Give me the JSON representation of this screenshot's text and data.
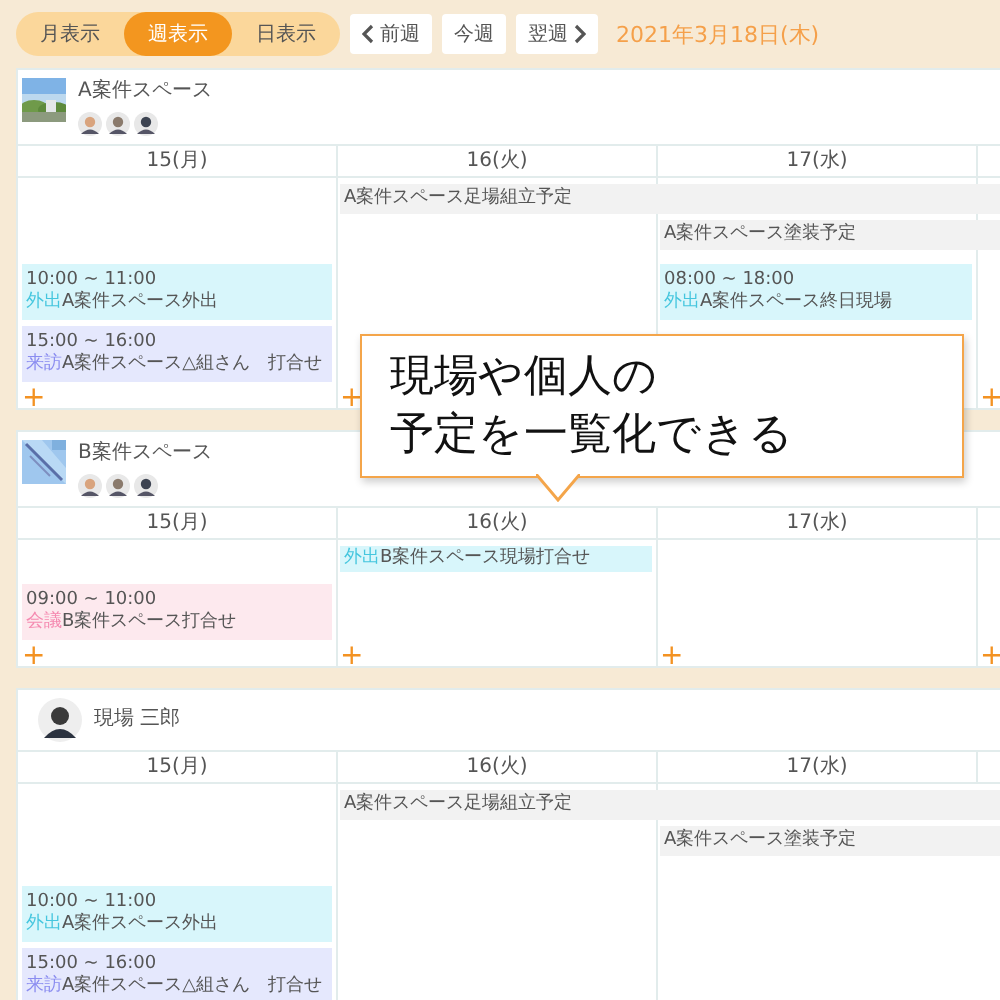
{
  "toolbar": {
    "views": [
      {
        "label": "月表示",
        "selected": false
      },
      {
        "label": "週表示",
        "selected": true
      },
      {
        "label": "日表示",
        "selected": false
      }
    ],
    "nav": [
      {
        "label": "前週",
        "kind": "prev"
      },
      {
        "label": "今週",
        "kind": "today"
      },
      {
        "label": "翌週",
        "kind": "next"
      }
    ],
    "date": "2021年3月18日(木)"
  },
  "cards": [
    {
      "kind": "space",
      "title": "A案件スペース",
      "days": [
        {
          "label": "15(月)",
          "add": "+",
          "events": [
            {
              "kind": "outing",
              "time": "10:00 ~ 11:00",
              "tag": "外出",
              "text": "A案件スペース外出"
            },
            {
              "kind": "visit",
              "time": "15:00 ~ 16:00",
              "tag": "来訪",
              "text": "A案件スペース△組さん　打合せ"
            }
          ]
        },
        {
          "label": "16(火)",
          "add": "+",
          "events": [
            {
              "kind": "bar",
              "text": "A案件スペース足場組立予定",
              "continues": true
            }
          ]
        },
        {
          "label": "17(水)",
          "events": [
            {
              "kind": "bar",
              "text": "A案件スペース塗装予定",
              "continues": true
            },
            {
              "kind": "outing",
              "time": "08:00 ~ 18:00",
              "tag": "外出",
              "text": "A案件スペース終日現場"
            }
          ]
        },
        {
          "add": "+"
        }
      ]
    },
    {
      "kind": "space",
      "title": "B案件スペース",
      "days": [
        {
          "label": "15(月)",
          "add": "+",
          "events": [
            {
              "kind": "meeting",
              "time": "09:00 ~ 10:00",
              "tag": "会議",
              "text": "B案件スペース打合せ"
            }
          ]
        },
        {
          "label": "16(火)",
          "add": "+",
          "events": [
            {
              "kind": "outing",
              "tag": "外出",
              "text": "B案件スペース現場打合せ"
            }
          ]
        },
        {
          "label": "17(水)",
          "add": "+"
        },
        {
          "add": "+"
        }
      ]
    },
    {
      "kind": "person",
      "title": "現場 三郎",
      "days": [
        {
          "label": "15(月)",
          "events": [
            {
              "kind": "outing",
              "time": "10:00 ~ 11:00",
              "tag": "外出",
              "text": "A案件スペース外出"
            },
            {
              "kind": "visit",
              "time": "15:00 ~ 16:00",
              "tag": "来訪",
              "text": "A案件スペース△組さん　打合せ"
            }
          ]
        },
        {
          "label": "16(火)",
          "events": [
            {
              "kind": "bar",
              "text": "A案件スペース足場組立予定",
              "continues": true
            }
          ]
        },
        {
          "label": "17(水)",
          "events": [
            {
              "kind": "bar",
              "text": "A案件スペース塗装予定",
              "continues": true
            }
          ]
        }
      ]
    }
  ],
  "callout": {
    "lines": [
      "現場や個人の",
      "予定を一覧化できる"
    ]
  }
}
